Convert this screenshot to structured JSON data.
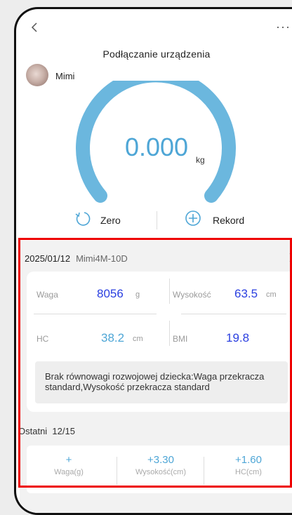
{
  "header": {
    "title": "Podłączanie urządzenia",
    "more_label": "···"
  },
  "user": {
    "name": "Mimi"
  },
  "scale": {
    "value": "0.000",
    "unit": "kg"
  },
  "actions": {
    "zero_label": "Zero",
    "rekord_label": "Rekord"
  },
  "record": {
    "date": "2025/01/12",
    "device": "Mimi4M-10D",
    "weight": {
      "label": "Waga",
      "value": "8056",
      "unit": "g"
    },
    "height": {
      "label": "Wysokość",
      "value": "63.5",
      "unit": "cm"
    },
    "hc": {
      "label": "HC",
      "value": "38.2",
      "unit": "cm"
    },
    "bmi": {
      "label": "BMI",
      "value": "19.8"
    },
    "warning": "Brak równowagi rozwojowej dziecka:Waga przekracza standard,Wysokość przekracza standard"
  },
  "recent": {
    "label": "Ostatni",
    "date": "12/15",
    "items": [
      {
        "value": "+",
        "label": "Waga(g)"
      },
      {
        "value": "+3.30",
        "label": "Wysokość(cm)"
      },
      {
        "value": "+1.60",
        "label": "HC(cm)"
      }
    ]
  },
  "colors": {
    "accent": "#4ea6d6",
    "value_blue": "#2a3fe0",
    "highlight": "#e00000"
  }
}
